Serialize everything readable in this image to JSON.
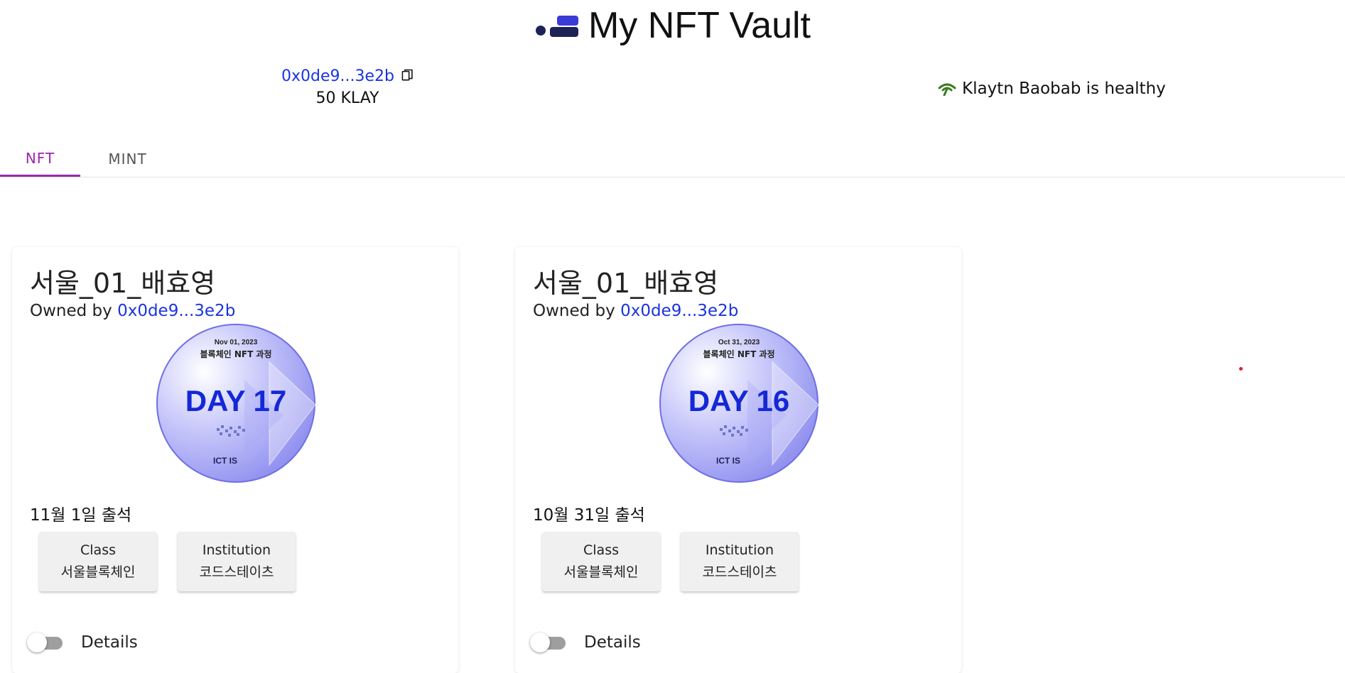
{
  "header": {
    "title": "My NFT Vault",
    "logo_icon": "vault-logo-icon"
  },
  "account": {
    "address": "0x0de9...3e2b",
    "balance": "50 KLAY",
    "copy_icon": "copy-icon"
  },
  "network": {
    "status": "Klaytn Baobab is healthy",
    "icon": "antenna-signal-icon",
    "color": "#3a7d22"
  },
  "tabs": [
    {
      "label": "NFT",
      "active": true
    },
    {
      "label": "MINT",
      "active": false
    }
  ],
  "accent": "#9c27b0",
  "link_color": "#1a34e0",
  "nfts": [
    {
      "name": "서울_01_배효영",
      "owned_by_label": "Owned by",
      "owner": "0x0de9...3e2b",
      "badge_date": "Nov 01, 2023",
      "badge_course": "블록체인 NFT 과정",
      "badge_day": "DAY 17",
      "badge_org": "ICT IS",
      "description": "11월 1일 출석",
      "class_label": "Class",
      "class_value": "서울블록체인",
      "institution_label": "Institution",
      "institution_value": "코드스테이츠",
      "details_label": "Details",
      "details_on": false
    },
    {
      "name": "서울_01_배효영",
      "owned_by_label": "Owned by",
      "owner": "0x0de9...3e2b",
      "badge_date": "Oct 31, 2023",
      "badge_course": "블록체인 NFT 과정",
      "badge_day": "DAY 16",
      "badge_org": "ICT IS",
      "description": "10월 31일 출석",
      "class_label": "Class",
      "class_value": "서울블록체인",
      "institution_label": "Institution",
      "institution_value": "코드스테이츠",
      "details_label": "Details",
      "details_on": false
    }
  ]
}
